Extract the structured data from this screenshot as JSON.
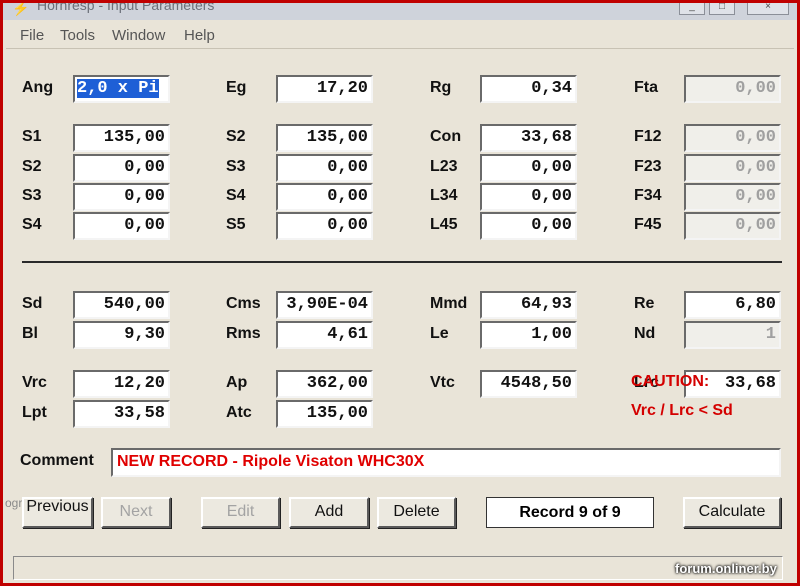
{
  "window": {
    "title": "Hornresp - Input Parameters",
    "app_icon": "lightning-icon",
    "controls": [
      "_",
      "□",
      "×"
    ]
  },
  "menu": [
    "File",
    "Tools",
    "Window",
    "Help"
  ],
  "params_top": [
    {
      "label": "Ang",
      "value": "2,0 x Pi",
      "selected": true
    },
    {
      "label": "Eg",
      "value": "17,20"
    },
    {
      "label": "Rg",
      "value": "0,34"
    },
    {
      "label": "Fta",
      "value": "0,00",
      "disabled": true
    },
    {
      "label": "S1",
      "value": "135,00"
    },
    {
      "label": "S2",
      "value": "135,00"
    },
    {
      "label": "Con",
      "value": "33,68"
    },
    {
      "label": "F12",
      "value": "0,00",
      "disabled": true
    },
    {
      "label": "S2",
      "value": "0,00"
    },
    {
      "label": "S3",
      "value": "0,00"
    },
    {
      "label": "L23",
      "value": "0,00"
    },
    {
      "label": "F23",
      "value": "0,00",
      "disabled": true
    },
    {
      "label": "S3",
      "value": "0,00"
    },
    {
      "label": "S4",
      "value": "0,00"
    },
    {
      "label": "L34",
      "value": "0,00"
    },
    {
      "label": "F34",
      "value": "0,00",
      "disabled": true
    },
    {
      "label": "S4",
      "value": "0,00"
    },
    {
      "label": "S5",
      "value": "0,00"
    },
    {
      "label": "L45",
      "value": "0,00"
    },
    {
      "label": "F45",
      "value": "0,00",
      "disabled": true
    }
  ],
  "params_bottom": [
    {
      "label": "Sd",
      "value": "540,00"
    },
    {
      "label": "Cms",
      "value": "3,90E-04"
    },
    {
      "label": "Mmd",
      "value": "64,93"
    },
    {
      "label": "Re",
      "value": "6,80"
    },
    {
      "label": "Bl",
      "value": "9,30"
    },
    {
      "label": "Rms",
      "value": "4,61"
    },
    {
      "label": "Le",
      "value": "1,00"
    },
    {
      "label": "Nd",
      "value": "1",
      "disabled": true
    },
    {
      "label": "Vrc",
      "value": "12,20"
    },
    {
      "label": "Ap",
      "value": "362,00"
    },
    {
      "label": "Vtc",
      "value": "4548,50"
    },
    {
      "label": "Lrc",
      "value": "33,68"
    },
    {
      "label": "Lpt",
      "value": "33,58"
    },
    {
      "label": "Atc",
      "value": "135,00"
    }
  ],
  "caution": {
    "title": "CAUTION:",
    "message": "Vrc / Lrc < Sd",
    "color": "#d40000"
  },
  "comment": {
    "label": "Comment",
    "value": "NEW RECORD - Ripole Visaton WHC30X"
  },
  "buttons": {
    "previous": "Previous",
    "next": "Next",
    "edit": "Edit",
    "add": "Add",
    "delete": "Delete",
    "calculate": "Calculate"
  },
  "record_status": "Record 9 of 9",
  "watermark": "forum.onliner.by"
}
